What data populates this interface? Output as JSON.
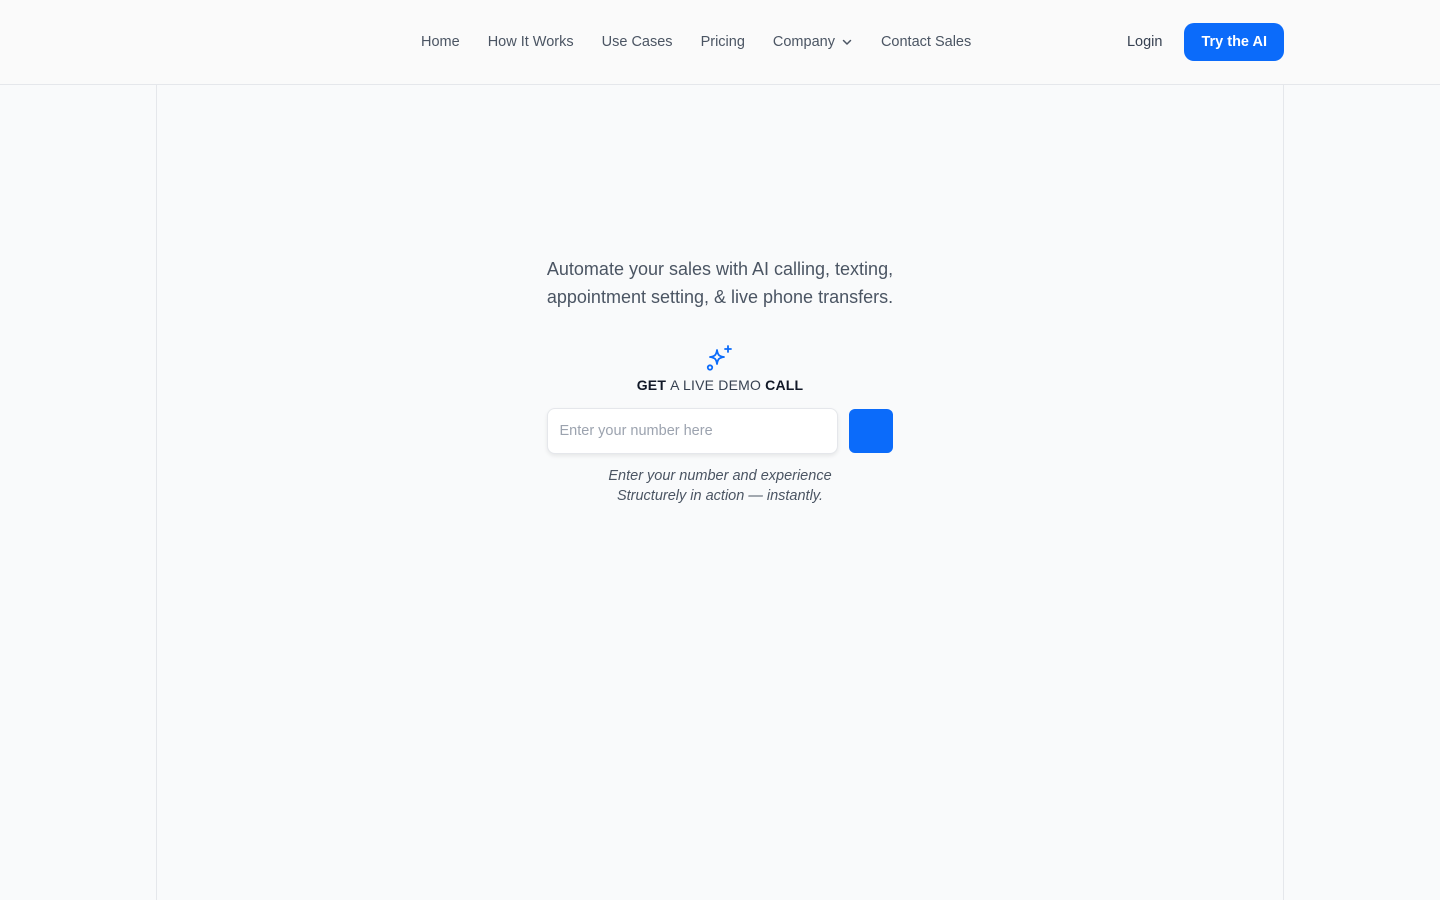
{
  "nav": {
    "items": [
      {
        "label": "Home"
      },
      {
        "label": "How It Works"
      },
      {
        "label": "Use Cases"
      },
      {
        "label": "Pricing"
      },
      {
        "label": "Company",
        "icon": "chevron-down-icon"
      },
      {
        "label": "Contact Sales"
      }
    ],
    "login_label": "Login",
    "cta_label": "Try the AI"
  },
  "hero": {
    "tagline_line1": "Automate your sales with AI calling, texting,",
    "tagline_line2": "appointment setting, & live phone transfers.",
    "icon": "sparkles-icon",
    "demo_label_start": "GET ",
    "demo_label_middle": "A LIVE DEMO",
    "demo_label_end": " CALL",
    "phone_placeholder": "Enter your number here",
    "helper_line1": "Enter your number and experience",
    "helper_line2": "Structurely in action — instantly."
  },
  "colors": {
    "accent": "#0b6bfa",
    "background": "#f9fafb",
    "border": "#e5e7eb"
  }
}
